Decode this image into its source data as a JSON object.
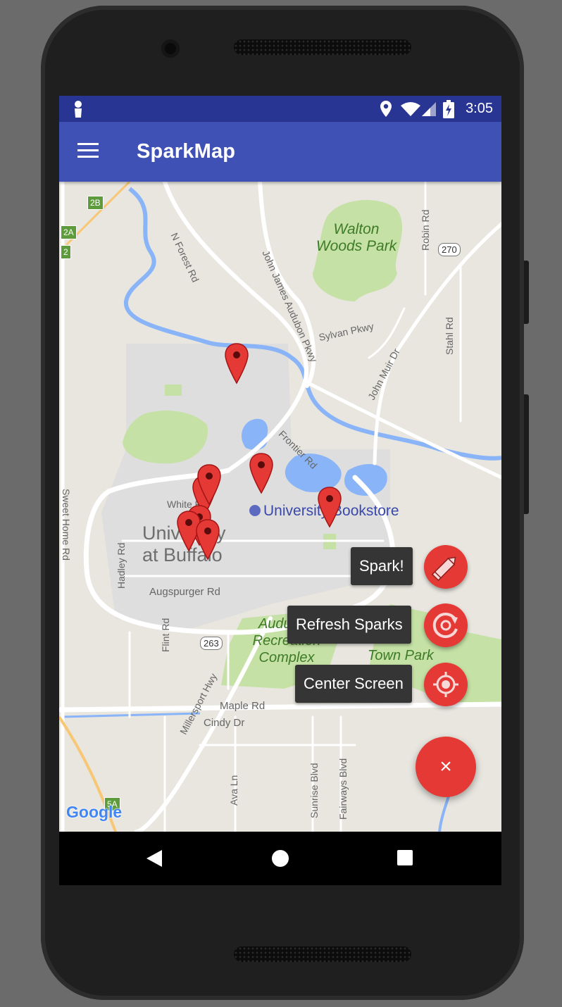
{
  "status_bar": {
    "time": "3:05"
  },
  "app_bar": {
    "title": "SparkMap",
    "menu_icon": "hamburger-menu-icon"
  },
  "map": {
    "places": [
      "Walton Woods Park",
      "University Bookstore",
      "University at Buffalo",
      "Audubon Recreation Complex",
      "Town Park"
    ],
    "roads": [
      "N Forest Rd",
      "John James Audubon Pkwy",
      "Sylvan Pkwy",
      "John Muir Dr",
      "Robin Rd",
      "Stahl Rd",
      "Frontier Rd",
      "White Rd",
      "Hadley Rd",
      "Augspurger Rd",
      "Sweet Home Rd",
      "Flint Rd",
      "Millersport Hwy",
      "Maple Rd",
      "Cindy Dr",
      "Ava Ln",
      "Sunrise Blvd",
      "Fairways Blvd"
    ],
    "shields": [
      "2B",
      "2A",
      "2",
      "270",
      "263",
      "5A"
    ],
    "attribution": "Google",
    "marker_count": 8
  },
  "fab_menu": {
    "items": [
      {
        "label": "Spark!",
        "icon": "pencil-icon"
      },
      {
        "label": "Refresh Sparks",
        "icon": "refresh-icon"
      },
      {
        "label": "Center Screen",
        "icon": "target-location-icon"
      }
    ],
    "main_fab_label": "×"
  },
  "colors": {
    "status_bar": "#283593",
    "app_bar": "#3f51b5",
    "fab": "#e53935",
    "park": "#c5e1a5",
    "water": "#8ab4f8",
    "marker": "#e53935"
  }
}
